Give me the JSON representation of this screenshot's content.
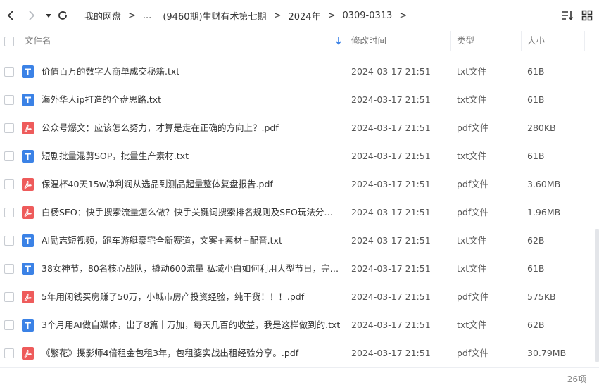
{
  "breadcrumb": [
    "我的网盘",
    "...",
    "(9460期)生财有术第七期",
    "2024年",
    "0309-0313"
  ],
  "header": {
    "name": "文件名",
    "modified": "修改时间",
    "type": "类型",
    "size": "大小"
  },
  "files": [
    {
      "name": "价值百万的数字人商单成交秘籍.txt",
      "modified": "2024-03-17 21:51",
      "type": "txt文件",
      "size": "61B",
      "kind": "txt"
    },
    {
      "name": "海外华人ip打造的全盘思路.txt",
      "modified": "2024-03-17 21:51",
      "type": "txt文件",
      "size": "61B",
      "kind": "txt"
    },
    {
      "name": "公众号爆文：应该怎么努力，才算是走在正确的方向上？.pdf",
      "modified": "2024-03-17 21:51",
      "type": "pdf文件",
      "size": "280KB",
      "kind": "pdf"
    },
    {
      "name": "短剧批量混剪SOP，批量生产素材.txt",
      "modified": "2024-03-17 21:51",
      "type": "txt文件",
      "size": "61B",
      "kind": "txt"
    },
    {
      "name": "保温杯40天15w净利润从选品到测品起量整体复盘报告.pdf",
      "modified": "2024-03-17 21:51",
      "type": "pdf文件",
      "size": "3.60MB",
      "kind": "pdf"
    },
    {
      "name": "白杨SEO：快手搜索流量怎么做？快手关键词搜索排名规则及SEO玩法分享.pdf",
      "modified": "2024-03-17 21:51",
      "type": "pdf文件",
      "size": "1.96MB",
      "kind": "pdf"
    },
    {
      "name": "AI励志短视频，跑车游艇豪宅全新赛道，文案+素材+配音.txt",
      "modified": "2024-03-17 21:51",
      "type": "txt文件",
      "size": "62B",
      "kind": "txt"
    },
    {
      "name": "38女神节，80名核心战队，撬动600流量 私域小白如何利用大型节日，完成社...",
      "modified": "2024-03-17 21:51",
      "type": "txt文件",
      "size": "61B",
      "kind": "txt"
    },
    {
      "name": "5年用闲钱买房赚了50万，小城市房产投资经验，纯干货！！！.pdf",
      "modified": "2024-03-17 21:51",
      "type": "pdf文件",
      "size": "575KB",
      "kind": "pdf"
    },
    {
      "name": "3个月用AI做自媒体，出了8篇十万加，每天几百的收益，我是这样做到的.txt",
      "modified": "2024-03-17 21:51",
      "type": "txt文件",
      "size": "62B",
      "kind": "txt"
    },
    {
      "name": "《繁花》摄影师4倍租金包租3年，包租婆实战出租经验分享。.pdf",
      "modified": "2024-03-17 21:51",
      "type": "pdf文件",
      "size": "30.79MB",
      "kind": "pdf"
    }
  ],
  "count": "26项",
  "colors": {
    "txt": "#3b82e6",
    "pdf": "#ee5b5b",
    "sort": "#3b82e6"
  }
}
